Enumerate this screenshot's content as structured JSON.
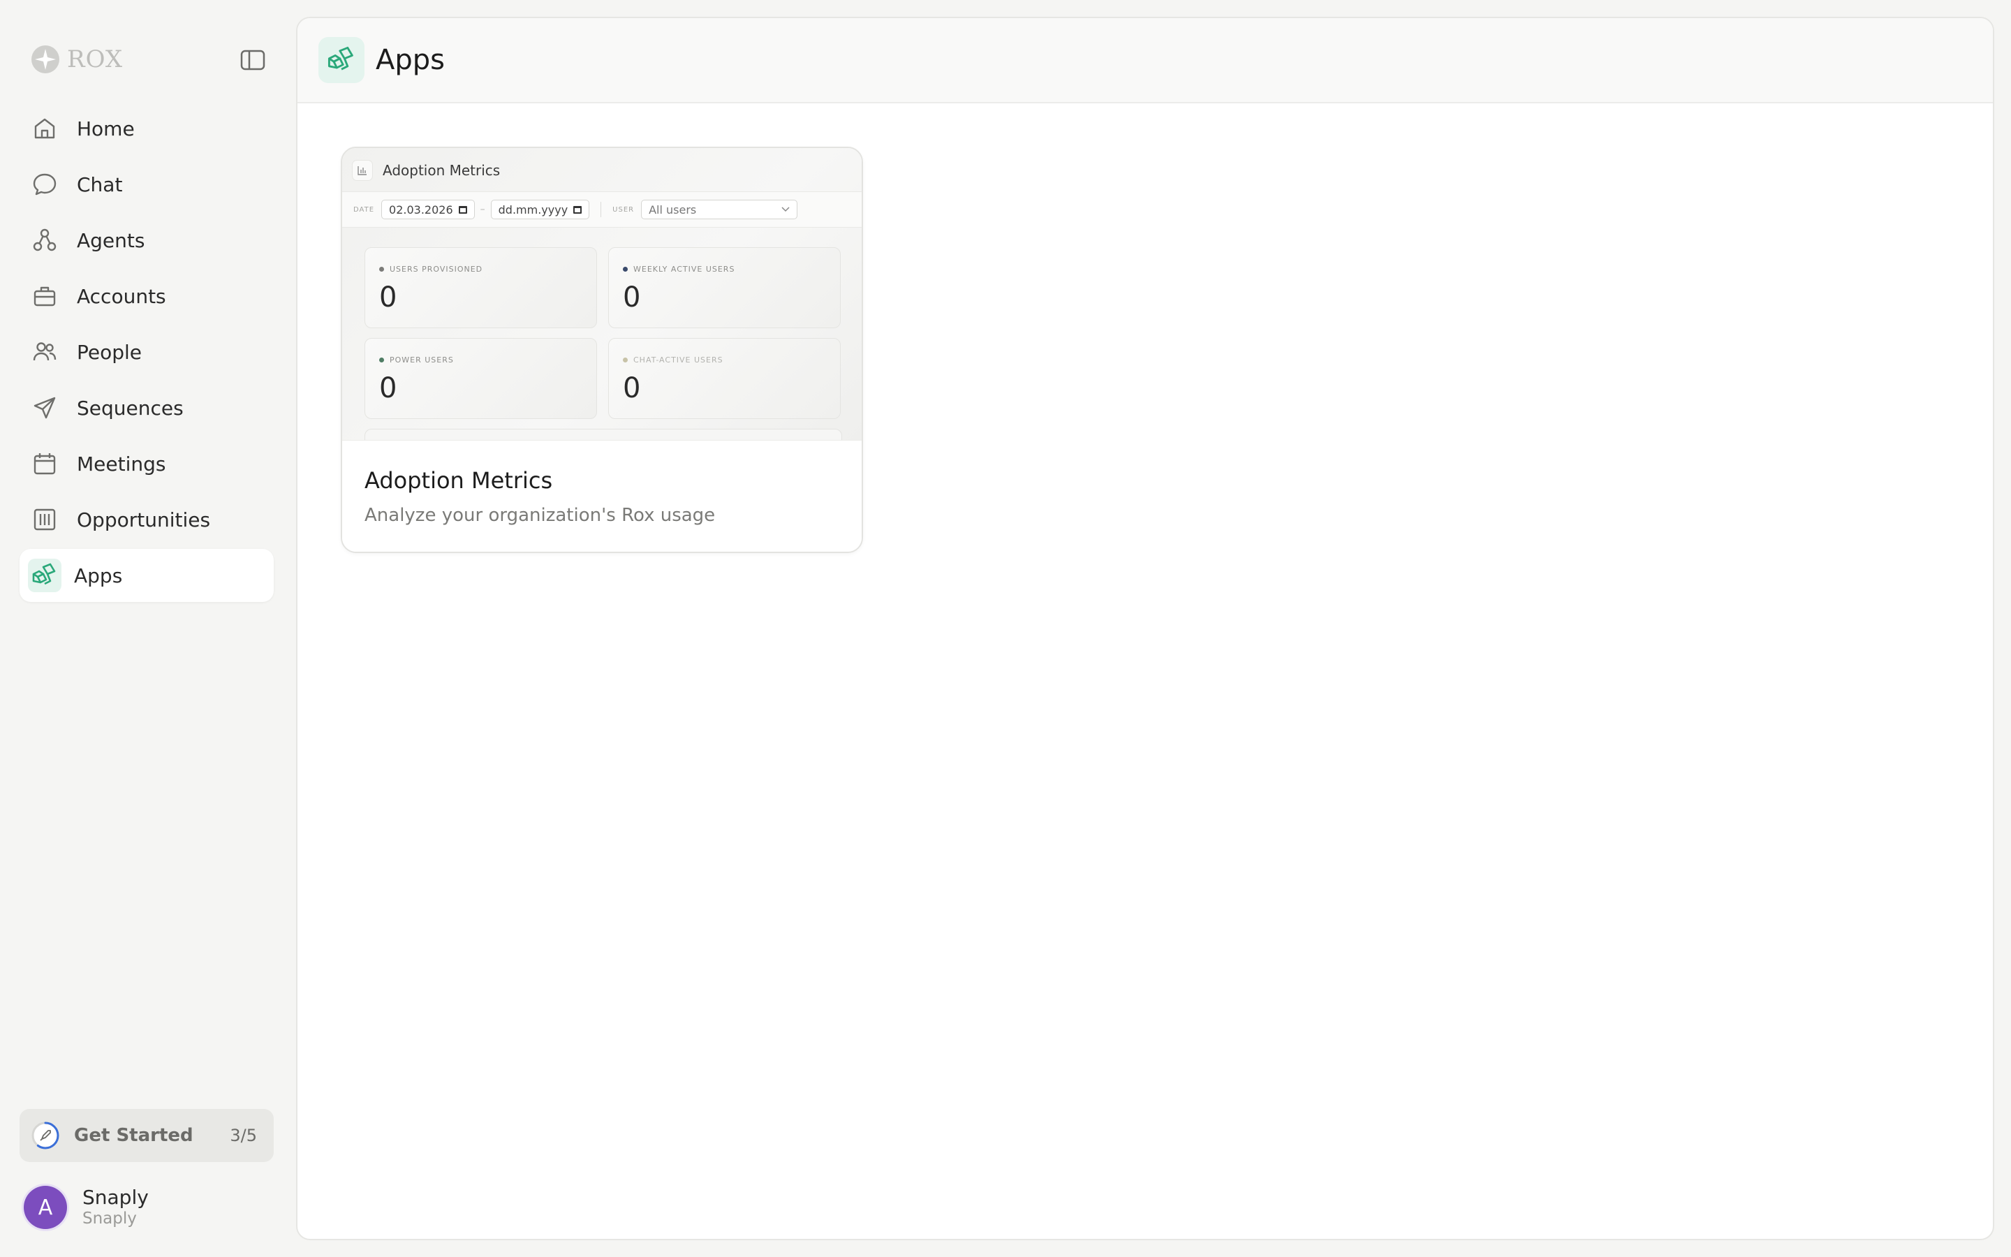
{
  "sidebar": {
    "brand": "ROX",
    "items": [
      {
        "label": "Home",
        "icon": "home-icon"
      },
      {
        "label": "Chat",
        "icon": "chat-bubble-icon"
      },
      {
        "label": "Agents",
        "icon": "agents-icon"
      },
      {
        "label": "Accounts",
        "icon": "briefcase-icon"
      },
      {
        "label": "People",
        "icon": "people-icon"
      },
      {
        "label": "Sequences",
        "icon": "paper-plane-icon"
      },
      {
        "label": "Meetings",
        "icon": "calendar-icon"
      },
      {
        "label": "Opportunities",
        "icon": "columns-icon"
      },
      {
        "label": "Apps",
        "icon": "apps-icon",
        "active": true
      }
    ],
    "get_started": {
      "label": "Get Started",
      "count": "3/5",
      "progress": 0.6
    },
    "user": {
      "initial": "A",
      "name": "Snaply",
      "org": "Snaply"
    }
  },
  "header": {
    "title": "Apps"
  },
  "apps": [
    {
      "title": "Adoption Metrics",
      "description": "Analyze your organization's Rox usage",
      "preview": {
        "title": "Adoption Metrics",
        "date_label": "DATE",
        "date_from": "02.03.2026",
        "date_to": "dd.mm.yyyy",
        "date_separator": "–",
        "user_label": "USER",
        "user_select": "All users",
        "metrics": [
          {
            "label": "USERS PROVISIONED",
            "value": "0"
          },
          {
            "label": "WEEKLY ACTIVE USERS",
            "value": "0"
          },
          {
            "label": "POWER USERS",
            "value": "0"
          },
          {
            "label": "CHAT-ACTIVE USERS",
            "value": "0"
          }
        ]
      }
    }
  ],
  "colors": {
    "accent": "#2aa87a",
    "accent_bg": "#e4f4ee",
    "avatar": "#7c4dbe",
    "progress": "#3b6fd8"
  }
}
